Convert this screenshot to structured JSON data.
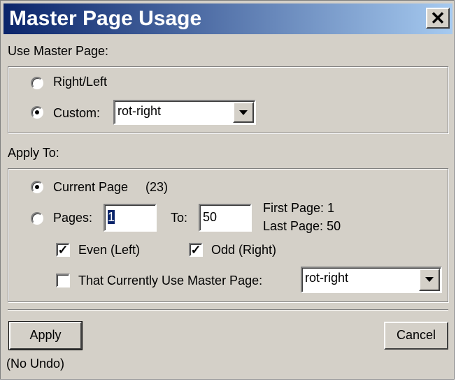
{
  "dialog": {
    "title": "Master Page Usage",
    "close_glyph": "✕",
    "use_master_page_label": "Use Master Page:",
    "right_left_label": "Right/Left",
    "custom_label": "Custom:",
    "custom_combo_value": "rot-right",
    "apply_to_label": "Apply To:",
    "current_page_label": "Current Page",
    "current_page_number": "(23)",
    "pages_label": "Pages:",
    "pages_from_value": "1",
    "to_label": "To:",
    "pages_to_value": "50",
    "first_page_text": "First Page: 1",
    "last_page_text": "Last Page: 50",
    "even_label": "Even (Left)",
    "odd_label": "Odd (Right)",
    "that_currently_label": "That Currently Use Master Page:",
    "that_currently_combo_value": "rot-right",
    "apply_button": "Apply",
    "cancel_button": "Cancel",
    "no_undo_text": "(No Undo)"
  },
  "state": {
    "master_page_choice": "custom",
    "apply_to_choice": "current_page",
    "even_checked": true,
    "odd_checked": true,
    "that_currently_checked": false
  }
}
